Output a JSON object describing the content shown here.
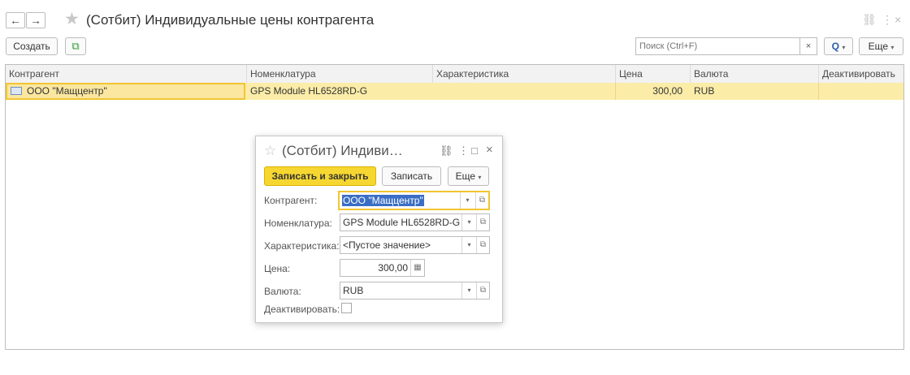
{
  "window": {
    "title": "(Сотбит) Индивидуальные цены контрагента",
    "back_icon": "←",
    "forward_icon": "→",
    "favorite_icon": "★",
    "link_icon": "⛓",
    "more_icon": "⋮",
    "close_icon": "×"
  },
  "toolbar": {
    "create_label": "Создать",
    "copy_icon": "⧉",
    "search_placeholder": "Поиск (Ctrl+F)",
    "search_clear": "×",
    "search_button_icon": "Q",
    "dropdown_icon": "▾",
    "more_label": "Еще"
  },
  "table": {
    "columns": [
      "Контрагент",
      "Номенклатура",
      "Характеристика",
      "Цена",
      "Валюта",
      "Деактивировать"
    ],
    "rows": [
      {
        "counterparty": "ООО \"Мащцентр\"",
        "item": "GPS Module HL6528RD-G",
        "characteristic": "",
        "price": "300,00",
        "currency": "RUB",
        "deactivate": ""
      }
    ]
  },
  "dialog": {
    "title": "(Сотбит) Индиви…",
    "favorite_icon": "☆",
    "link_icon": "⛓",
    "more_icon": "⋮",
    "maximize_icon": "□",
    "close_icon": "×",
    "save_close_label": "Записать и закрыть",
    "save_label": "Записать",
    "more_label": "Еще",
    "dropdown_icon": "▾",
    "open_icon": "⧉",
    "calc_icon": "▦",
    "fields": {
      "counterparty_label": "Контрагент:",
      "counterparty_value": "ООО \"Мащцентр\"",
      "item_label": "Номенклатура:",
      "item_value": "GPS Module HL6528RD-G",
      "characteristic_label": "Характеристика:",
      "characteristic_value": "<Пустое значение>",
      "price_label": "Цена:",
      "price_value": "300,00",
      "currency_label": "Валюта:",
      "currency_value": "RUB",
      "deactivate_label": "Деактивировать:",
      "deactivate_checked": false
    }
  }
}
